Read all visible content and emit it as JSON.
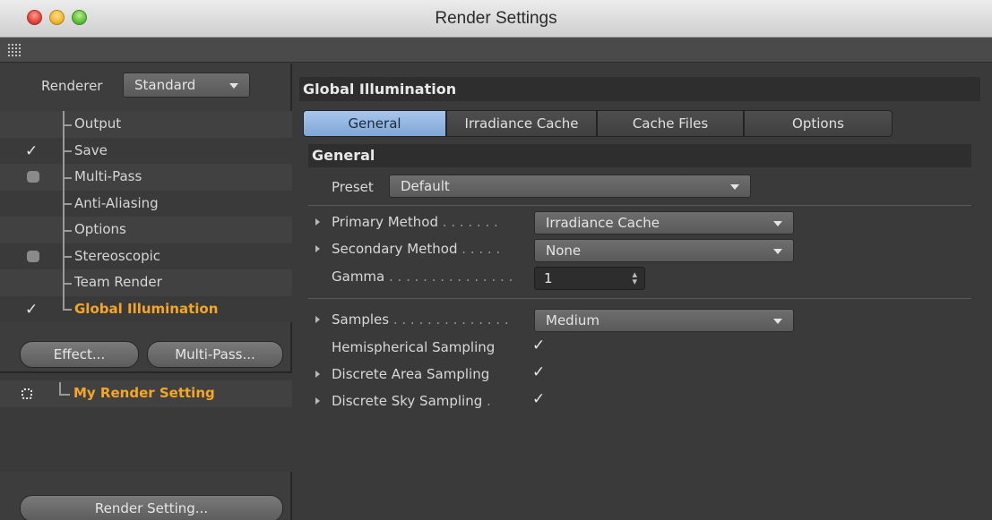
{
  "window": {
    "title": "Render Settings"
  },
  "left": {
    "renderer_label": "Renderer",
    "renderer_value": "Standard",
    "tree": [
      {
        "label": "Output",
        "check": "none"
      },
      {
        "label": "Save",
        "check": "checked"
      },
      {
        "label": "Multi-Pass",
        "check": "unchecked"
      },
      {
        "label": "Anti-Aliasing",
        "check": "none"
      },
      {
        "label": "Options",
        "check": "none"
      },
      {
        "label": "Stereoscopic",
        "check": "unchecked"
      },
      {
        "label": "Team Render",
        "check": "none"
      },
      {
        "label": "Global Illumination",
        "check": "checked",
        "active": true
      }
    ],
    "effect_button": "Effect...",
    "multipass_button": "Multi-Pass...",
    "render_setting_name": "My Render Setting",
    "render_setting_button": "Render Setting..."
  },
  "right": {
    "panel_title": "Global Illumination",
    "tabs": [
      "General",
      "Irradiance Cache",
      "Cache Files",
      "Options"
    ],
    "active_tab": "General",
    "section_title": "General",
    "preset_label": "Preset",
    "preset_value": "Default",
    "primary_method_label": "Primary Method",
    "primary_method_dots": ". . . . . . .",
    "primary_method_value": "Irradiance Cache",
    "secondary_method_label": "Secondary Method",
    "secondary_method_dots": ". . . . .",
    "secondary_method_value": "None",
    "gamma_label": "Gamma",
    "gamma_dots": ". . . . . . . . . . . . . . .",
    "gamma_value": "1",
    "samples_label": "Samples",
    "samples_dots": ". . . . . . . . . . . . . .",
    "samples_value": "Medium",
    "hemispherical_label": "Hemispherical Sampling",
    "hemispherical_checked": true,
    "discrete_area_label": "Discrete Area Sampling",
    "discrete_area_checked": true,
    "discrete_sky_label": "Discrete Sky Sampling",
    "discrete_sky_dots": ".",
    "discrete_sky_checked": true
  },
  "colors": {
    "accent_orange": "#f5a623",
    "active_tab_blue": "#8fb2de",
    "panel_bg": "#3a3a3a"
  }
}
